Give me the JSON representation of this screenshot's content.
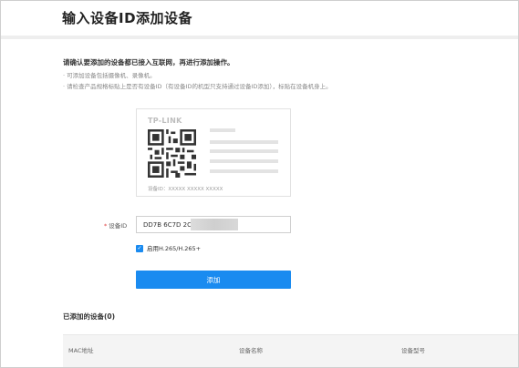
{
  "page": {
    "title": "输入设备ID添加设备"
  },
  "notice": {
    "main": "请确认要添加的设备都已接入互联网，再进行添加操作。",
    "lines": [
      "· 可添加设备包括摄像机、录像机。",
      "· 请检查产品规格标贴上是否有设备ID（有设备ID的机型只支持通过设备ID添加），标贴在设备机身上。"
    ]
  },
  "card": {
    "brand": "TP-LINK",
    "id_example": "设备ID：XXXXX XXXXX XXXXX",
    "qr_icon": "qr-code-icon"
  },
  "form": {
    "required_mark": "*",
    "device_id_label": "设备ID",
    "device_id_value": "DD7B 6C7D 2CE",
    "h265_label": "启用H.265/H.265+",
    "h265_checked": true,
    "add_button": "添加"
  },
  "added": {
    "title": "已添加的设备(0)",
    "columns": [
      "MAC地址",
      "设备名称",
      "设备型号"
    ]
  },
  "colors": {
    "accent": "#1a8bf0",
    "required": "#e04040"
  }
}
